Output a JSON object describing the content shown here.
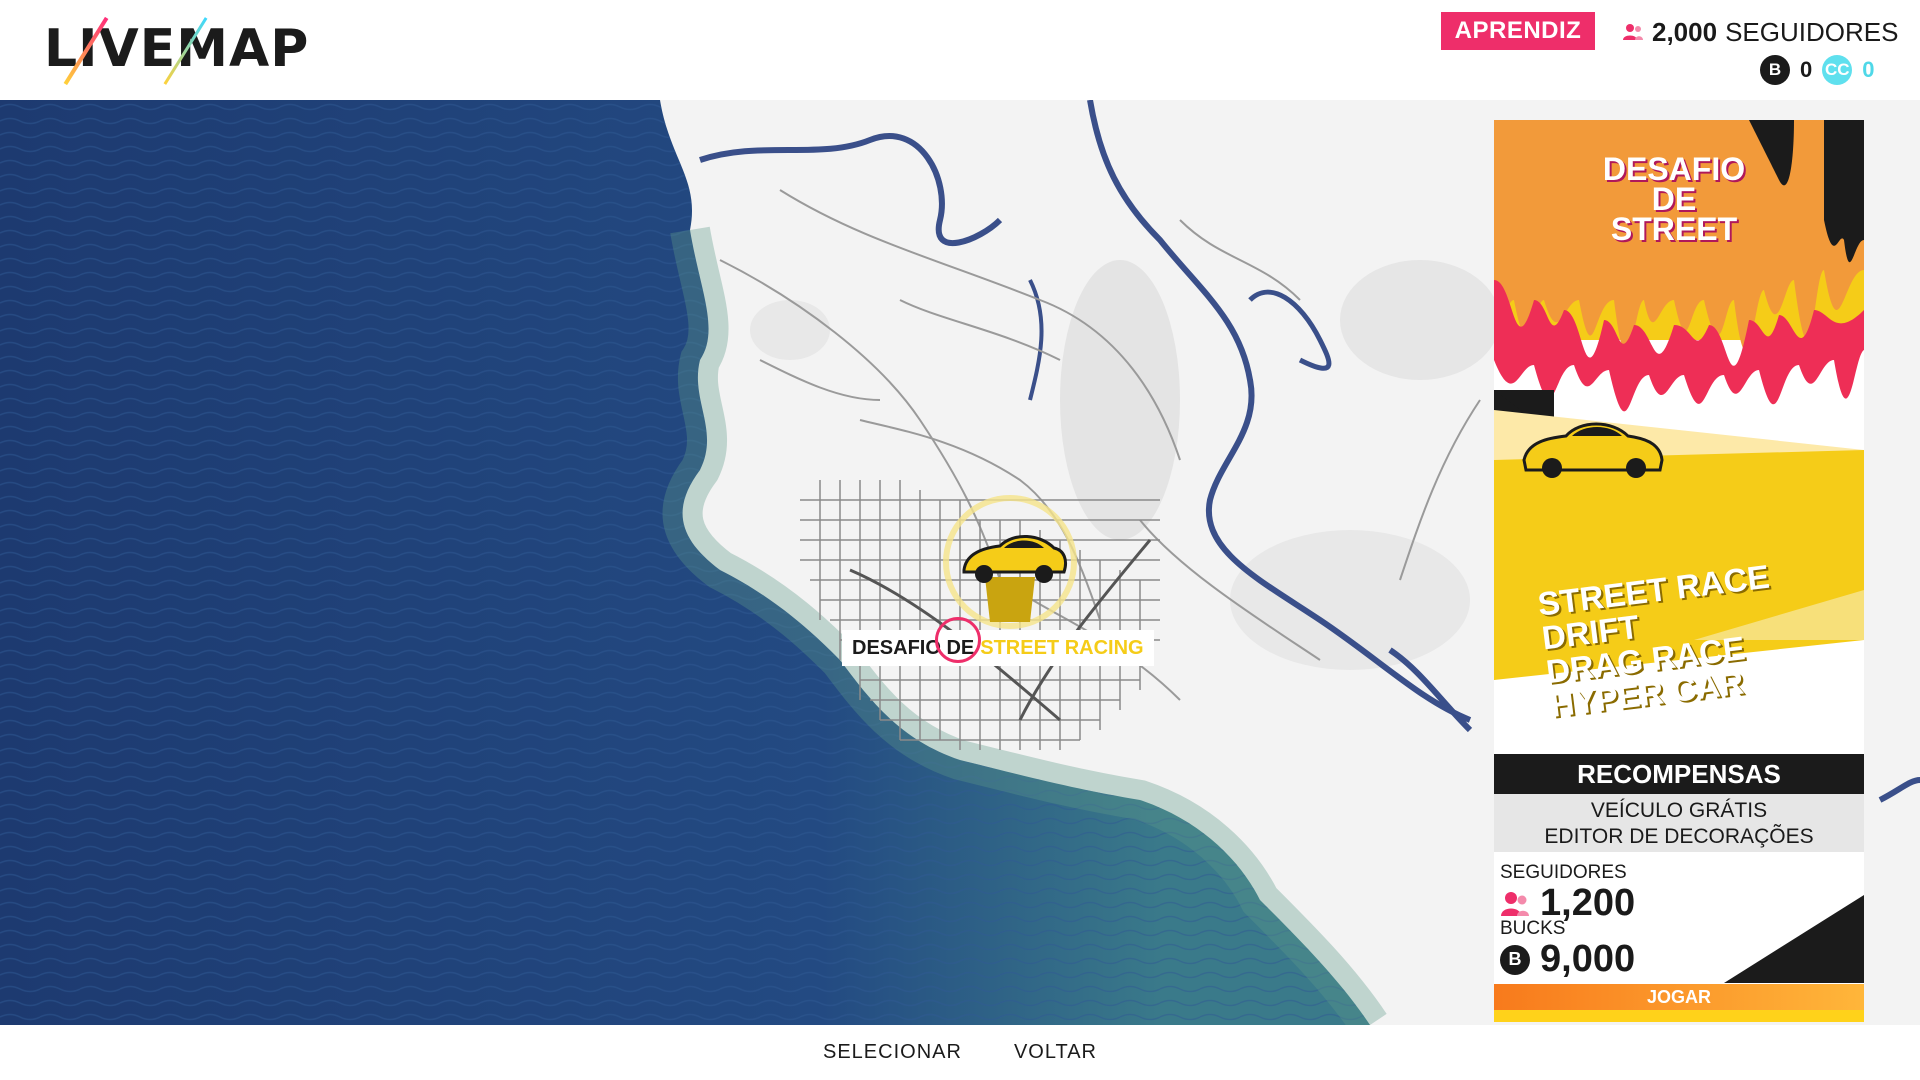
{
  "header": {
    "logo": "LIVEMAP",
    "rank": "APRENDIZ",
    "followers_value": "2,000",
    "followers_label": "SEGUIDORES",
    "bucks_icon": "B",
    "bucks_value": "0",
    "cc_icon": "CC",
    "cc_value": "0"
  },
  "map": {
    "event_label_part1": "DESAFIO DE",
    "event_label_part2": "STREET RACING"
  },
  "panel": {
    "title_lines": [
      "DESAFIO",
      "DE",
      "STREET"
    ],
    "modes": [
      "STREET RACE",
      "DRIFT",
      "DRAG RACE",
      "HYPER CAR"
    ],
    "rewards_header": "RECOMPENSAS",
    "rewards": [
      "VEÍCULO GRÁTIS",
      "EDITOR DE DECORAÇÕES"
    ],
    "followers_label": "SEGUIDORES",
    "followers_value": "1,200",
    "bucks_label": "BUCKS",
    "bucks_value": "9,000",
    "play": "JOGAR"
  },
  "footer": {
    "select": "SELECIONAR",
    "back": "VOLTAR"
  },
  "colors": {
    "accent_pink": "#ee2e6a",
    "accent_yellow": "#f5cc18",
    "accent_cyan": "#4fd8e8",
    "ocean": "#1f3f78"
  }
}
